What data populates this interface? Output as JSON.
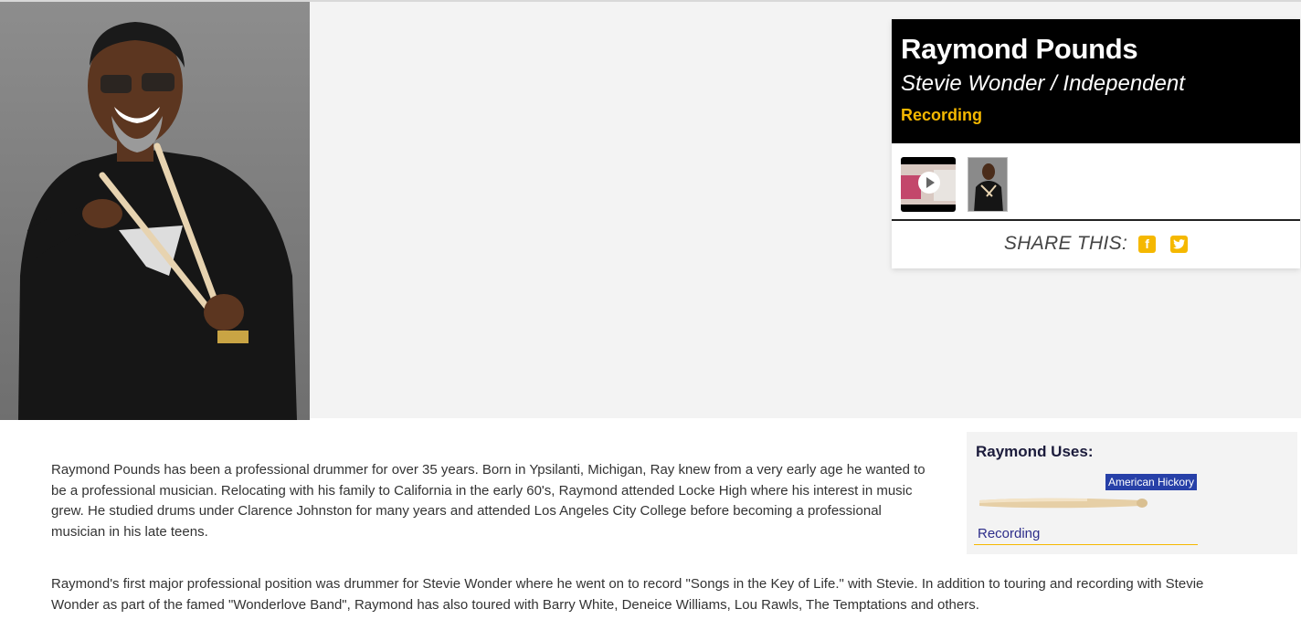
{
  "artist": {
    "name": "Raymond Pounds",
    "band": "Stevie Wonder / Independent",
    "category": "Recording"
  },
  "share": {
    "label": "SHARE THIS:"
  },
  "bio": {
    "p1": "Raymond Pounds has been a professional drummer for over 35 years. Born in Ypsilanti, Michigan, Ray knew from a very early age he wanted to be a professional musician. Relocating with his family to California in the early 60's, Raymond attended Locke High where his interest in music grew. He studied drums under Clarence Johnston for many years and attended Los Angeles City College before becoming a professional musician in his late teens.",
    "p2": "Raymond's first major professional position was drummer for Stevie Wonder where he went on to record \"Songs in the Key of Life.\" with Stevie. In addition to touring and recording with Stevie Wonder as part of the famed \"Wonderlove Band\", Raymond has also toured with Barry White, Deneice Williams, Lou Rawls, The Temptations and others."
  },
  "uses": {
    "title": "Raymond Uses:",
    "tag": "American Hickory",
    "link": "Recording"
  },
  "colors": {
    "accent": "#f5b800",
    "tag_blue": "#2740a8"
  }
}
